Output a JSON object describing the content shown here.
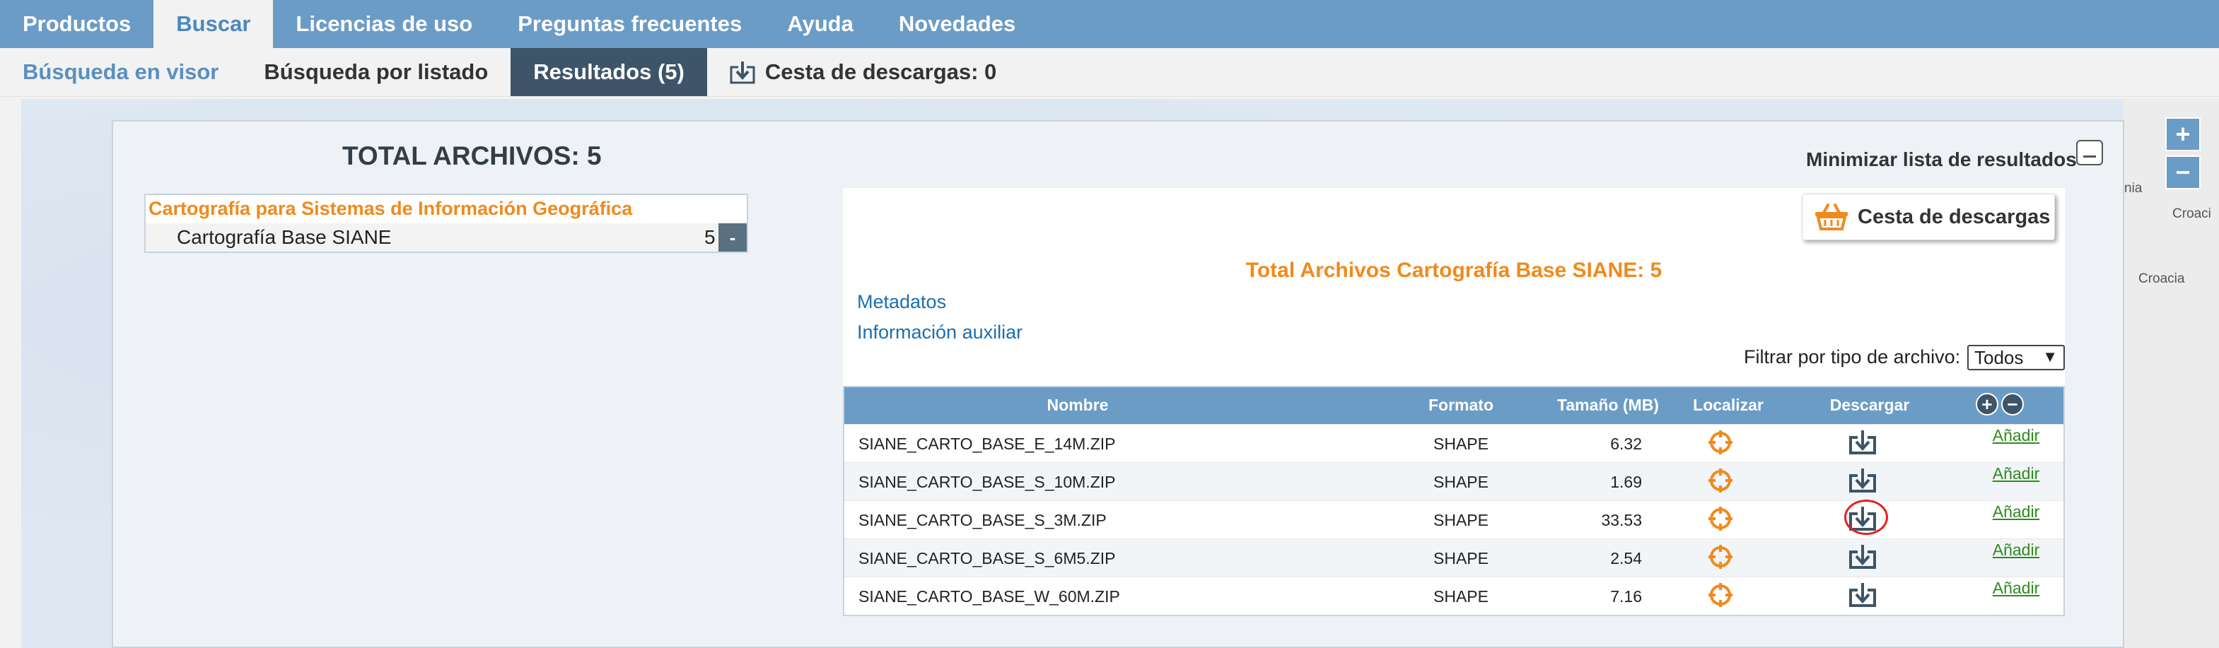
{
  "topnav": {
    "items": [
      {
        "label": "Productos"
      },
      {
        "label": "Buscar"
      },
      {
        "label": "Licencias de uso"
      },
      {
        "label": "Preguntas frecuentes"
      },
      {
        "label": "Ayuda"
      },
      {
        "label": "Novedades"
      }
    ],
    "active": "Buscar"
  },
  "subnav": {
    "items": [
      {
        "label": "Búsqueda en visor"
      },
      {
        "label": "Búsqueda por listado"
      },
      {
        "label": "Resultados (5)"
      },
      {
        "label": "Cesta de descargas: 0"
      }
    ],
    "active": "Resultados (5)"
  },
  "map": {
    "labels": [
      "nia",
      "Croaci",
      "Croacia"
    ],
    "zoom_in": "+",
    "zoom_out": "−"
  },
  "results": {
    "total_title": "TOTAL ARCHIVOS: 5",
    "minimize_label": "Minimizar lista de resultados",
    "tree": {
      "category": "Cartografía para Sistemas de Información Geográfica",
      "subcategory": "Cartografía Base SIANE",
      "count": "5",
      "collapse": "-"
    },
    "cart_button": "Cesta de descargas",
    "files_title": "Total Archivos Cartografía Base SIANE: 5",
    "links": {
      "metadata": "Metadatos",
      "aux_info": "Información auxiliar"
    },
    "filter": {
      "label": "Filtrar por tipo de archivo:",
      "value": "Todos",
      "arrow": "▼"
    },
    "table": {
      "headers": {
        "name": "Nombre",
        "format": "Formato",
        "size": "Tamaño (MB)",
        "locate": "Localizar",
        "download": "Descargar",
        "add_all": "+",
        "remove_all": "−"
      },
      "rows": [
        {
          "name": "SIANE_CARTO_BASE_E_14M.ZIP",
          "format": "SHAPE",
          "size": "6.32",
          "add": "Añadir"
        },
        {
          "name": "SIANE_CARTO_BASE_S_10M.ZIP",
          "format": "SHAPE",
          "size": "1.69",
          "add": "Añadir"
        },
        {
          "name": "SIANE_CARTO_BASE_S_3M.ZIP",
          "format": "SHAPE",
          "size": "33.53",
          "add": "Añadir"
        },
        {
          "name": "SIANE_CARTO_BASE_S_6M5.ZIP",
          "format": "SHAPE",
          "size": "2.54",
          "add": "Añadir"
        },
        {
          "name": "SIANE_CARTO_BASE_W_60M.ZIP",
          "format": "SHAPE",
          "size": "7.16",
          "add": "Añadir"
        }
      ]
    }
  },
  "colors": {
    "nav": "#6b9cc6",
    "active_subnav": "#3e5468",
    "orange": "#f08a1c",
    "link": "#1a6fb0",
    "add_link": "#2f8a1f",
    "highlight": "#e52020"
  }
}
